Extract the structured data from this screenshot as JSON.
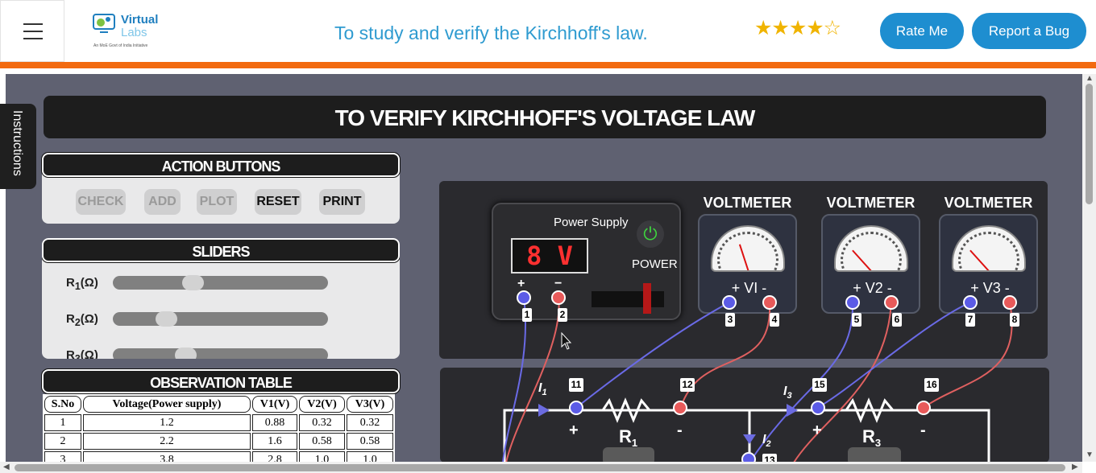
{
  "header": {
    "menu_icon": "hamburger-menu-icon",
    "logo_line1": "Virtual",
    "logo_line2": "Labs",
    "logo_tagline": "An MoE Govt of India Initiative",
    "title": "To study and verify the Kirchhoff's law.",
    "rating": {
      "stars_filled": 4,
      "stars_total": 5,
      "display": "★★★★☆"
    },
    "rate_button": "Rate Me",
    "bug_button": "Report a Bug"
  },
  "colors": {
    "accent": "#1e8ed0",
    "orange": "#f26a10",
    "sim_bg": "#5f6171"
  },
  "sim": {
    "instructions_tab": "Instructions",
    "banner": "TO VERIFY KIRCHHOFF'S VOLTAGE LAW",
    "action_panel": {
      "title": "ACTION BUTTONS",
      "buttons": [
        {
          "label": "CHECK",
          "enabled": false
        },
        {
          "label": "ADD",
          "enabled": false
        },
        {
          "label": "PLOT",
          "enabled": false
        },
        {
          "label": "RESET",
          "enabled": true
        },
        {
          "label": "PRINT",
          "enabled": true
        }
      ]
    },
    "sliders_panel": {
      "title": "SLIDERS",
      "sliders": [
        {
          "label": "R",
          "sub": "1",
          "unit": "(Ω)",
          "level": 0.36
        },
        {
          "label": "R",
          "sub": "2",
          "unit": "(Ω)",
          "level": 0.22
        },
        {
          "label": "R",
          "sub": "3",
          "unit": "(Ω)",
          "level": 0.32
        }
      ]
    },
    "observation": {
      "title": "OBSERVATION TABLE",
      "headers": [
        "S.No",
        "Voltage(Power supply)",
        "V1(V)",
        "V2(V)",
        "V3(V)"
      ],
      "rows": [
        [
          "1",
          "1.2",
          "0.88",
          "0.32",
          "0.32"
        ],
        [
          "2",
          "2.2",
          "1.6",
          "0.58",
          "0.58"
        ],
        [
          "3",
          "3.8",
          "2.8",
          "1.0",
          "1.0"
        ]
      ]
    },
    "power_supply": {
      "title": "Power Supply",
      "display": "8 V",
      "power_label": "POWER",
      "power_icon": "power-icon",
      "terminal_plus": "+",
      "terminal_minus": "−",
      "terminals": [
        "1",
        "2"
      ]
    },
    "voltmeters": [
      {
        "title": "VOLTMETER",
        "label": "+ VI -",
        "terminals": [
          "3",
          "4"
        ],
        "reading": 0.35
      },
      {
        "title": "VOLTMETER",
        "label": "+ V2 -",
        "terminals": [
          "5",
          "6"
        ],
        "reading": 0.15
      },
      {
        "title": "VOLTMETER",
        "label": "+ V3 -",
        "terminals": [
          "7",
          "8"
        ],
        "reading": 0.15
      }
    ],
    "circuit": {
      "currents": [
        "I",
        "I",
        "I"
      ],
      "current_subs": [
        "1",
        "3",
        "2"
      ],
      "terminals": [
        "11",
        "12",
        "15",
        "16",
        "13"
      ],
      "resistors": [
        {
          "name": "R",
          "sub": "1"
        },
        {
          "name": "R",
          "sub": "3"
        }
      ],
      "plus": "+",
      "minus": "-"
    }
  }
}
